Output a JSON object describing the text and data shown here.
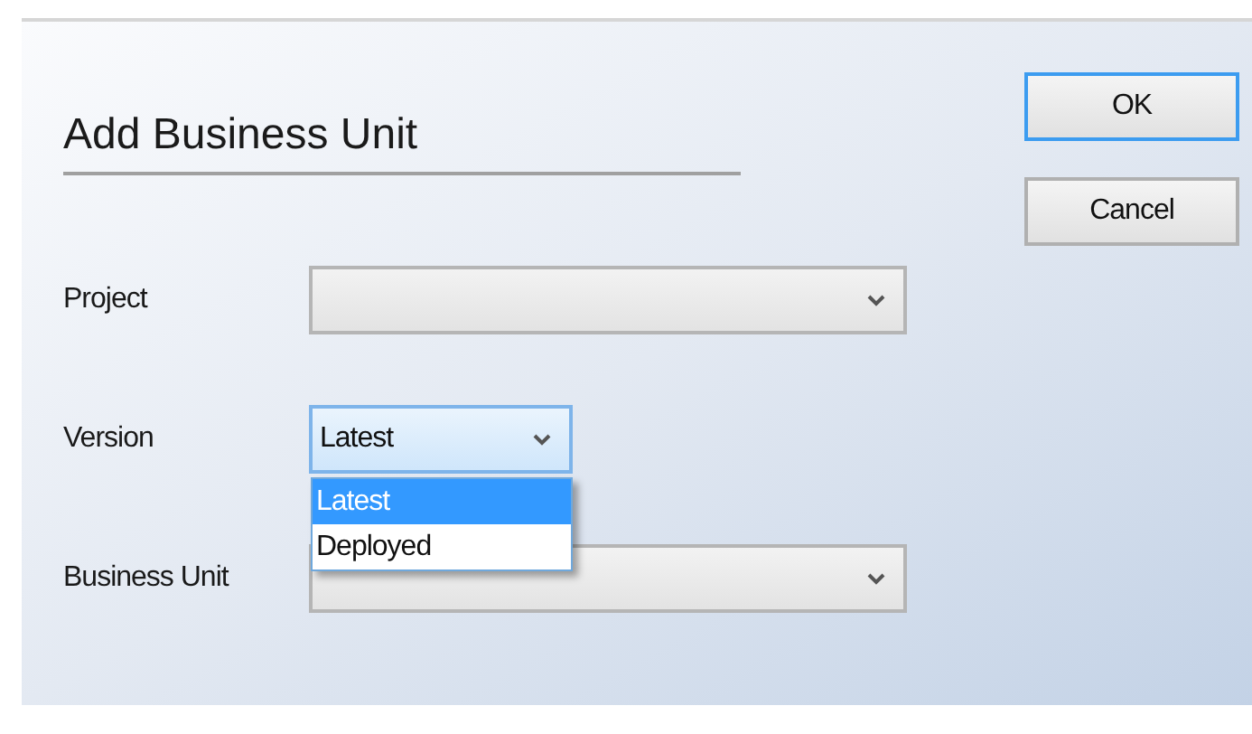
{
  "title": "Add Business Unit",
  "buttons": [
    {
      "label": "OK",
      "default": true
    },
    {
      "label": "Cancel",
      "default": false
    }
  ],
  "fields": [
    {
      "label": "Project",
      "focused": false
    },
    {
      "label": "Version",
      "value": "Latest",
      "focused": true,
      "options": [
        {
          "label": "Latest",
          "selected": true
        },
        {
          "label": "Deployed",
          "selected": false
        }
      ]
    },
    {
      "label": "Business Unit",
      "focused": false
    }
  ]
}
